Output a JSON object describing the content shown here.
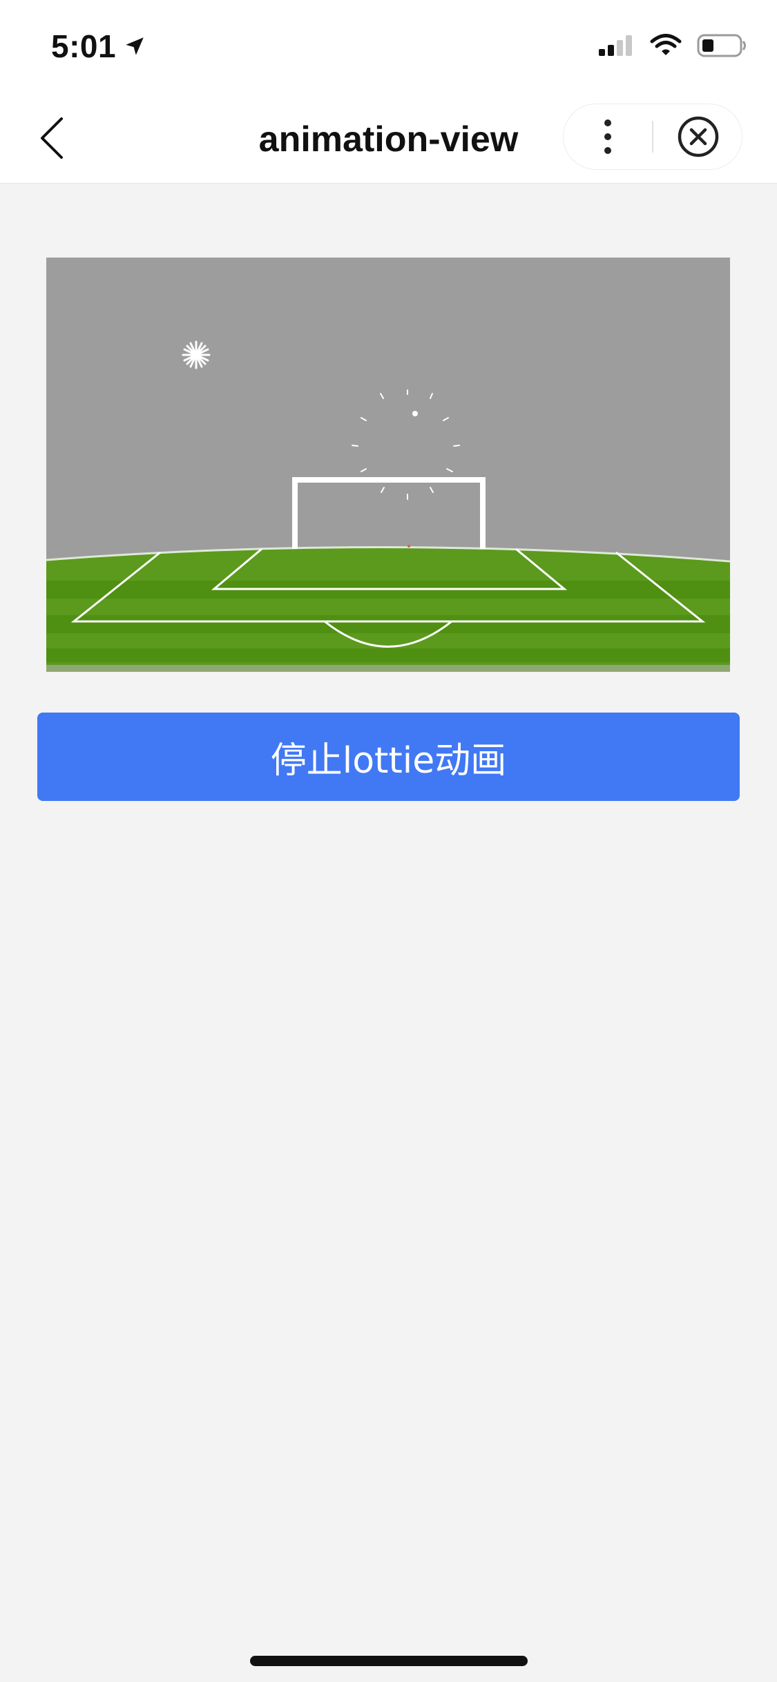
{
  "status_bar": {
    "time": "5:01",
    "icons": [
      "location-arrow-icon",
      "signal-icon",
      "wifi-icon",
      "battery-icon"
    ]
  },
  "nav_bar": {
    "title": "animation-view",
    "back_icon": "chevron-left-icon",
    "more_icon": "more-vertical-icon",
    "close_icon": "close-circle-icon"
  },
  "animation": {
    "scene": "lottie-football-goal",
    "sky_color": "#9d9d9d",
    "grass_colors": [
      "#5b9a1d",
      "#4f8f12"
    ],
    "line_color": "#ffffff"
  },
  "actions": {
    "stop_button_label": "停止lottie动画",
    "accent": "#4178f4"
  }
}
